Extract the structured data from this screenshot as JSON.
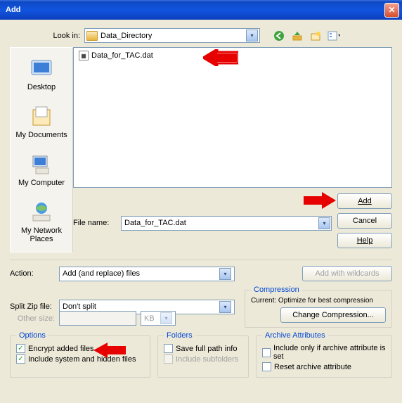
{
  "title": "Add",
  "lookin": {
    "label": "Look in:",
    "value": "Data_Directory"
  },
  "nav_icons": [
    "back-icon",
    "up-icon",
    "new-folder-icon",
    "views-icon"
  ],
  "places": [
    {
      "label": "Desktop",
      "name": "place-desktop"
    },
    {
      "label": "My Documents",
      "name": "place-my-documents"
    },
    {
      "label": "My Computer",
      "name": "place-my-computer"
    },
    {
      "label": "My Network Places",
      "name": "place-my-network"
    }
  ],
  "files": [
    {
      "label": "Data_for_TAC.dat"
    }
  ],
  "filename": {
    "label": "File name:",
    "value": "Data_for_TAC.dat"
  },
  "buttons": {
    "add": "Add",
    "cancel": "Cancel",
    "help": "Help",
    "wildcards": "Add with wildcards"
  },
  "action": {
    "label": "Action:",
    "value": "Add (and replace) files"
  },
  "split": {
    "label": "Split Zip file:",
    "value": "Don't split",
    "other_label": "Other size:",
    "unit": "KB"
  },
  "compression": {
    "legend": "Compression",
    "current": "Current: Optimize for best compression",
    "change": "Change Compression..."
  },
  "options": {
    "legend": "Options",
    "encrypt": "Encrypt added files",
    "include_hidden": "Include system and hidden files"
  },
  "folders": {
    "legend": "Folders",
    "save_full": "Save full path info",
    "include_sub": "Include subfolders"
  },
  "archive": {
    "legend": "Archive Attributes",
    "include_only": "Include only if archive attribute is set",
    "reset": "Reset archive attribute"
  }
}
